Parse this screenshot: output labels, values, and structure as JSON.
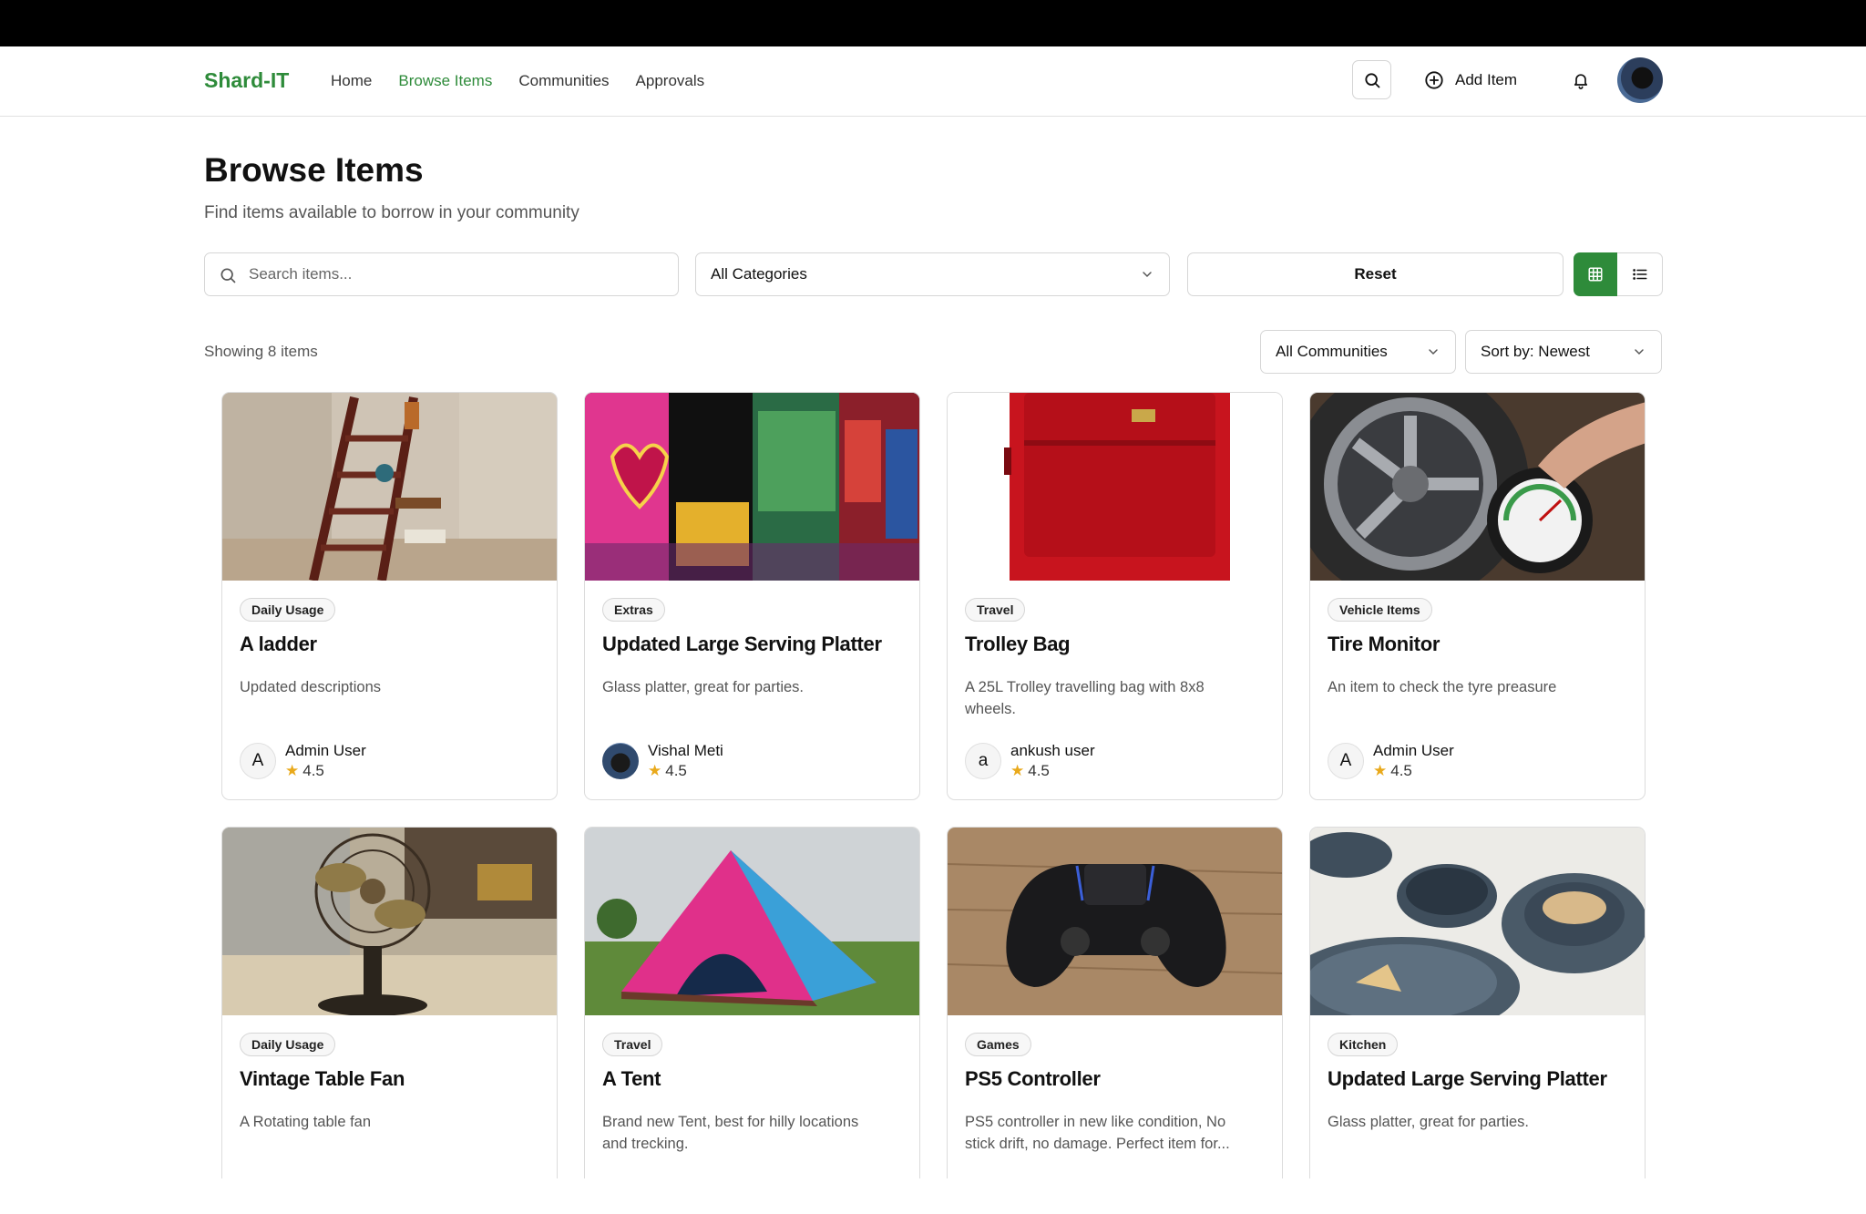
{
  "nav": {
    "logo": "Shard-IT",
    "links": [
      "Home",
      "Browse Items",
      "Communities",
      "Approvals"
    ],
    "active": "Browse Items",
    "add_item": "Add Item"
  },
  "page": {
    "title": "Browse Items",
    "subtitle": "Find items available to borrow in your community"
  },
  "filters": {
    "search_placeholder": "Search items...",
    "category": "All Categories",
    "reset": "Reset",
    "community": "All Communities",
    "sort": "Sort by: Newest"
  },
  "showing": "Showing 8 items",
  "colors": {
    "brand": "#2e8b3a",
    "star": "#e9a91b"
  },
  "items": [
    {
      "category": "Daily Usage",
      "name": "A ladder",
      "description": "Updated descriptions",
      "owner_initial": "A",
      "owner": "Admin User",
      "rating": "4.5"
    },
    {
      "category": "Extras",
      "name": "Updated Large Serving Platter",
      "description": "Glass platter, great for parties.",
      "owner_initial": "",
      "owner": "Vishal Meti",
      "rating": "4.5"
    },
    {
      "category": "Travel",
      "name": "Trolley Bag",
      "description": "A 25L Trolley travelling bag with 8x8 wheels.",
      "owner_initial": "a",
      "owner": "ankush user",
      "rating": "4.5"
    },
    {
      "category": "Vehicle Items",
      "name": "Tire Monitor",
      "description": "An item to check the tyre preasure",
      "owner_initial": "A",
      "owner": "Admin User",
      "rating": "4.5"
    },
    {
      "category": "Daily Usage",
      "name": "Vintage Table Fan",
      "description": "A Rotating table fan"
    },
    {
      "category": "Travel",
      "name": "A Tent",
      "description": "Brand new Tent, best for hilly locations and trecking."
    },
    {
      "category": "Games",
      "name": "PS5 Controller",
      "description": "PS5 controller in new like condition, No stick drift, no damage. Perfect item for..."
    },
    {
      "category": "Kitchen",
      "name": "Updated Large Serving Platter",
      "description": "Glass platter, great for parties."
    }
  ]
}
